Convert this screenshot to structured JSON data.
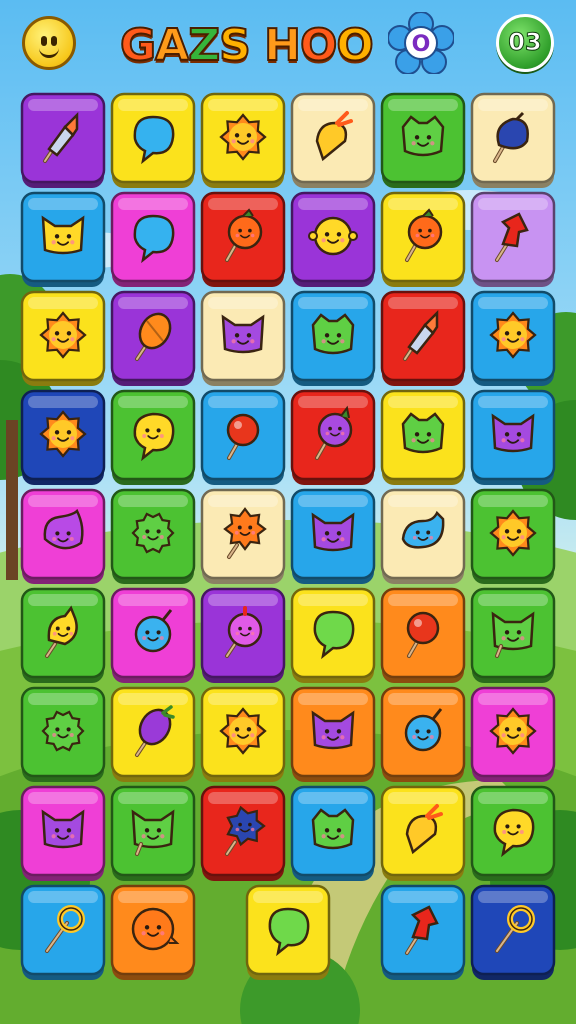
{
  "header": {
    "title_parts": [
      "G",
      "A",
      "Z",
      "S",
      " ",
      "H",
      "O",
      "O"
    ],
    "counter": "03",
    "flower_letter": "O"
  },
  "colors": {
    "purple": "#9a34d8",
    "yellow": "#fbe21c",
    "orange": "#ff8a1c",
    "cream": "#fbeab4",
    "green": "#4cc232",
    "blue": "#27a6ea",
    "pink": "#ef3fd6",
    "red": "#e8261c",
    "lilac": "#c893f2",
    "navy": "#1f47b8"
  },
  "board": {
    "columns": 6,
    "rows": [
      [
        [
          "purple",
          "rocket-pin"
        ],
        [
          "yellow",
          "blue-blob"
        ],
        [
          "yellow",
          "sun-face"
        ],
        [
          "cream",
          "carrot"
        ],
        [
          "green",
          "green-blob-face"
        ],
        [
          "cream",
          "navy-bomb"
        ]
      ],
      [
        [
          "blue",
          "yellow-cat-face"
        ],
        [
          "pink",
          "blue-blob"
        ],
        [
          "red",
          "orange-pin-face"
        ],
        [
          "purple",
          "yellow-face"
        ],
        [
          "yellow",
          "orange-pin-face"
        ],
        [
          "lilac",
          "red-pushpin"
        ]
      ],
      [
        [
          "yellow",
          "sun-face"
        ],
        [
          "purple",
          "orange-balloon-pin"
        ],
        [
          "cream",
          "purple-cat-face"
        ],
        [
          "blue",
          "green-blob-face"
        ],
        [
          "red",
          "rocket-pin"
        ],
        [
          "blue",
          "sun-face"
        ]
      ],
      [
        [
          "navy",
          "sun-face"
        ],
        [
          "green",
          "yellow-blob-face"
        ],
        [
          "blue",
          "red-pin"
        ],
        [
          "red",
          "purple-pin-face"
        ],
        [
          "yellow",
          "green-blob-face"
        ],
        [
          "blue",
          "purple-cat-face"
        ]
      ],
      [
        [
          "pink",
          "purple-blob-face"
        ],
        [
          "green",
          "green-spiky-face"
        ],
        [
          "cream",
          "sun-pin-face"
        ],
        [
          "blue",
          "purple-cat-face"
        ],
        [
          "cream",
          "blue-blob-face"
        ],
        [
          "green",
          "sun-face"
        ]
      ],
      [
        [
          "green",
          "yellow-pin-face"
        ],
        [
          "pink",
          "blue-balloon-face"
        ],
        [
          "purple",
          "pink-pin-face"
        ],
        [
          "yellow",
          "green-blob"
        ],
        [
          "orange",
          "red-pin"
        ],
        [
          "green",
          "green-cat-face"
        ]
      ],
      [
        [
          "green",
          "green-spiky-face"
        ],
        [
          "yellow",
          "purple-pin"
        ],
        [
          "yellow",
          "sun-face"
        ],
        [
          "orange",
          "purple-cat-face"
        ],
        [
          "orange",
          "blue-balloon-face"
        ],
        [
          "pink",
          "sun-face"
        ]
      ],
      [
        [
          "pink",
          "purple-cat-face"
        ],
        [
          "green",
          "green-cat-face"
        ],
        [
          "red",
          "navy-spiky-pin"
        ],
        [
          "blue",
          "green-blob-face"
        ],
        [
          "yellow",
          "carrot"
        ],
        [
          "green",
          "yellow-blob-face"
        ]
      ]
    ],
    "bottom_row": [
      [
        "blue",
        "key-pin",
        0
      ],
      [
        "orange",
        "orange-spiky-face",
        1
      ],
      [
        "yellow",
        "green-blob",
        2.5
      ],
      [
        "blue",
        "red-pushpin",
        4
      ],
      [
        "navy",
        "key-pin",
        5
      ]
    ]
  }
}
